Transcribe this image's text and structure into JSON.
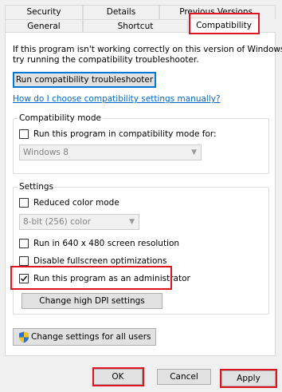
{
  "tabs": {
    "security": "Security",
    "details": "Details",
    "previous_versions": "Previous Versions",
    "general": "General",
    "shortcut": "Shortcut",
    "compatibility": "Compatibility"
  },
  "intro": {
    "line1": "If this program isn't working correctly on this version of Windows,",
    "line2": "try running the compatibility troubleshooter."
  },
  "troubleshooter_button": "Run compatibility troubleshooter",
  "help_link": "How do I choose compatibility settings manually?",
  "compat_mode": {
    "title": "Compatibility mode",
    "checkbox_label": "Run this program in compatibility mode for:",
    "checked": false,
    "os_value": "Windows 8"
  },
  "settings": {
    "title": "Settings",
    "reduced_color_label": "Reduced color mode",
    "reduced_color_checked": false,
    "color_value": "8-bit (256) color",
    "resolution_label": "Run in 640 x 480 screen resolution",
    "resolution_checked": false,
    "fullscreen_label": "Disable fullscreen optimizations",
    "fullscreen_checked": false,
    "admin_label": "Run this program as an administrator",
    "admin_checked": true,
    "dpi_button": "Change high DPI settings"
  },
  "all_users_button": "Change settings for all users",
  "footer": {
    "ok": "OK",
    "cancel": "Cancel",
    "apply": "Apply"
  },
  "colors": {
    "highlight": "#e0141e",
    "link": "#0066cc",
    "focus_border": "#0078d7"
  },
  "icons": {
    "shield": "uac-shield-icon",
    "check": "checkmark-icon",
    "dropdown": "chevron-down-icon"
  }
}
